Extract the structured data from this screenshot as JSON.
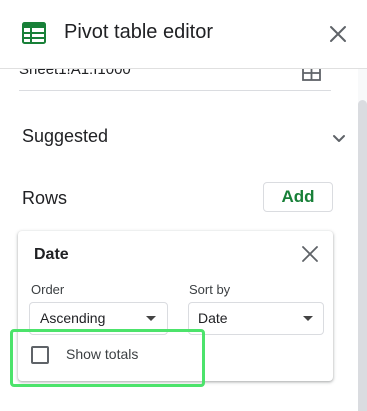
{
  "header": {
    "title": "Pivot table editor",
    "icon": "sheets-icon",
    "close_icon": "close-icon",
    "brand_color": "#188038"
  },
  "range": {
    "value": "Sheet1!A1:I1000",
    "icon": "grid-icon"
  },
  "suggested": {
    "label": "Suggested",
    "icon": "chevron-down-icon"
  },
  "rows": {
    "label": "Rows",
    "add_label": "Add"
  },
  "row_card": {
    "title": "Date",
    "order": {
      "label": "Order",
      "value": "Ascending"
    },
    "sort_by": {
      "label": "Sort by",
      "value": "Date"
    },
    "show_totals": {
      "label": "Show totals",
      "checked": false
    }
  },
  "highlight_color": "#4ce36b"
}
